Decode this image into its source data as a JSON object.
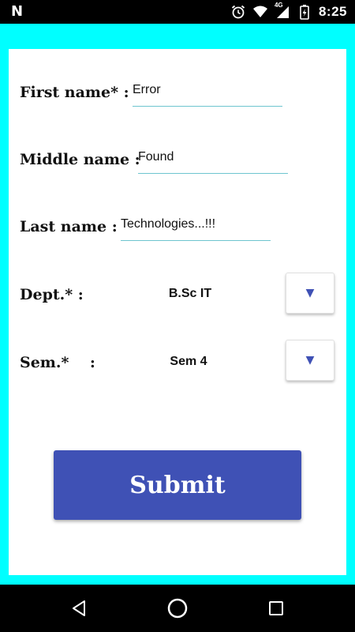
{
  "status_bar": {
    "time": "8:25",
    "network": "4G"
  },
  "form": {
    "first_name": {
      "label": "First name* :",
      "value": "Error"
    },
    "middle_name": {
      "label": "Middle name :",
      "value": "Found"
    },
    "last_name": {
      "label": "Last name :",
      "value": "Technologies...!!!"
    },
    "dept": {
      "label": "Dept.* :",
      "selected": "B.Sc IT"
    },
    "sem": {
      "label": "Sem.*    :",
      "selected": "Sem 4"
    },
    "submit_label": "Submit"
  },
  "colors": {
    "frame": "#00ffff",
    "accent": "#3f51b5",
    "underline": "#6ec5cf"
  }
}
